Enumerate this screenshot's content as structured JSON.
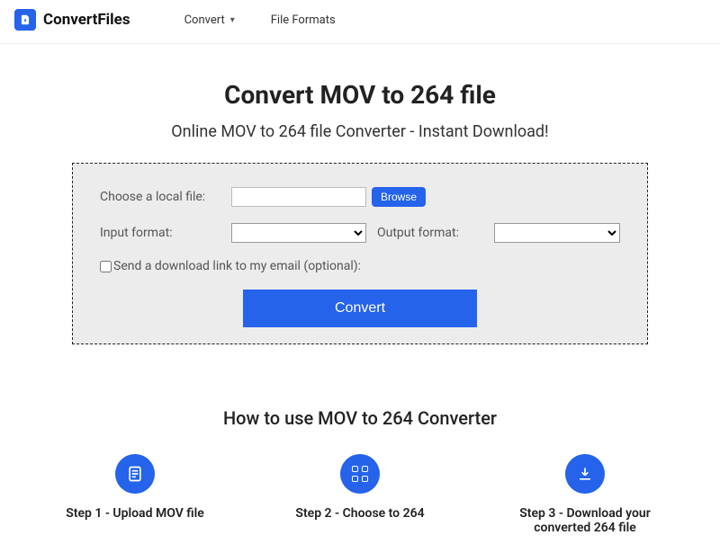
{
  "header": {
    "brand": "ConvertFiles",
    "nav": {
      "convert": "Convert",
      "formats": "File Formats"
    }
  },
  "main": {
    "title": "Convert MOV to 264 file",
    "subtitle": "Online MOV to 264 file Converter - Instant Download!"
  },
  "panel": {
    "choose_label": "Choose a local file:",
    "browse": "Browse",
    "input_format_label": "Input format:",
    "output_format_label": "Output format:",
    "email_label": "Send a download link to my email (optional):",
    "convert": "Convert"
  },
  "howto": {
    "title": "How to use MOV to 264 Converter",
    "steps": [
      "Step 1 - Upload MOV file",
      "Step 2 - Choose to 264",
      "Step 3 - Download your converted 264 file"
    ]
  }
}
